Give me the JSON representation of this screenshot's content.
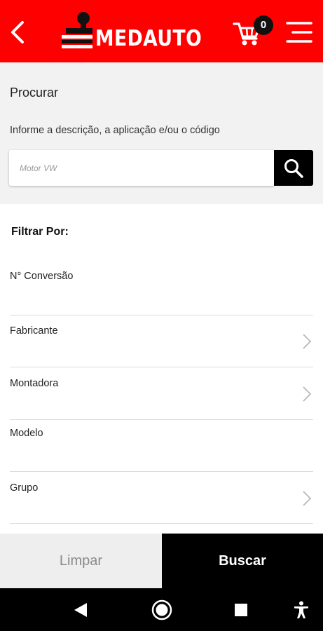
{
  "header": {
    "logo_text": "MEDAUTO",
    "cart_count": "0",
    "brand_color": "#ff0000",
    "icons": {
      "back": "arrow-left-icon",
      "cart": "shopping-cart-icon",
      "menu": "hamburger-menu-icon"
    }
  },
  "search": {
    "title": "Procurar",
    "hint": "Informe a descrição, a aplicação e/ou o código",
    "placeholder": "Motor VW",
    "button_icon": "search-icon"
  },
  "filters": {
    "title": "Filtrar Por:",
    "items": [
      {
        "label": "N° Conversão",
        "has_chevron": false
      },
      {
        "label": "Fabricante",
        "has_chevron": true
      },
      {
        "label": "Montadora",
        "has_chevron": true
      },
      {
        "label": "Modelo",
        "has_chevron": false
      },
      {
        "label": "Grupo",
        "has_chevron": true
      }
    ]
  },
  "actions": {
    "clear_label": "Limpar",
    "search_label": "Buscar"
  },
  "system_nav": {
    "icons": [
      "back-triangle-icon",
      "home-circle-icon",
      "recents-square-icon",
      "accessibility-icon"
    ]
  }
}
